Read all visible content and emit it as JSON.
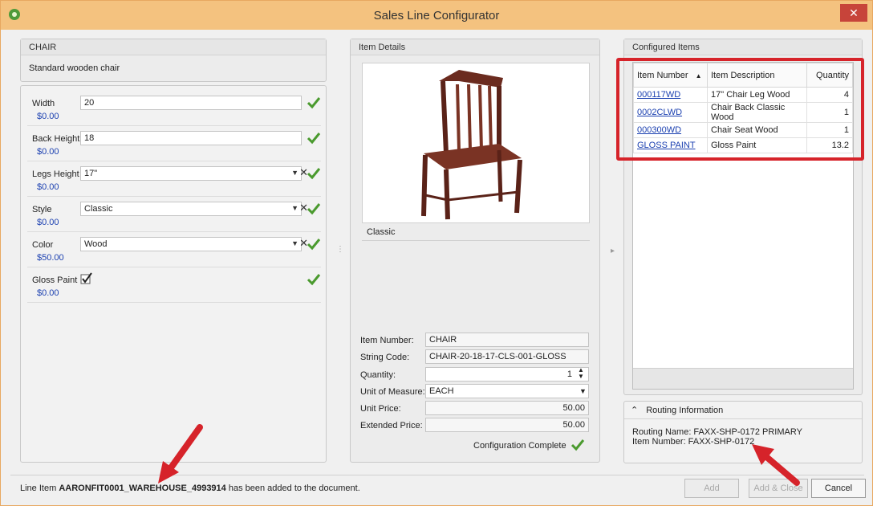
{
  "window": {
    "title": "Sales Line Configurator",
    "close_glyph": "✕"
  },
  "left": {
    "item_code": "CHAIR",
    "item_desc": "Standard wooden chair",
    "fields": [
      {
        "label": "Width",
        "value": "20",
        "price": "$0.00",
        "type": "text"
      },
      {
        "label": "Back Height",
        "value": "18",
        "price": "$0.00",
        "type": "text"
      },
      {
        "label": "Legs Height",
        "value": "17\"",
        "price": "$0.00",
        "type": "select"
      },
      {
        "label": "Style",
        "value": "Classic",
        "price": "$0.00",
        "type": "select"
      },
      {
        "label": "Color",
        "value": "Wood",
        "price": "$50.00",
        "type": "select"
      },
      {
        "label": "Gloss Paint",
        "value": "",
        "price": "$0.00",
        "type": "checkbox"
      }
    ]
  },
  "middle": {
    "header": "Item Details",
    "image_caption": "Classic",
    "labels": {
      "item_number": "Item Number:",
      "string_code": "String Code:",
      "quantity": "Quantity:",
      "uom": "Unit of Measure:",
      "unit_price": "Unit Price:",
      "extended_price": "Extended Price:"
    },
    "values": {
      "item_number": "CHAIR",
      "string_code": "CHAIR-20-18-17-CLS-001-GLOSS",
      "quantity": "1",
      "uom": "EACH",
      "unit_price": "50.00",
      "extended_price": "50.00"
    },
    "config_status": "Configuration Complete"
  },
  "right": {
    "header": "Configured Items",
    "columns": [
      "Item Number",
      "Item Description",
      "Quantity"
    ],
    "rows": [
      [
        "000117WD",
        "17\" Chair Leg Wood",
        "4"
      ],
      [
        "0002CLWD",
        "Chair Back Classic Wood",
        "1"
      ],
      [
        "000300WD",
        "Chair Seat Wood",
        "1"
      ],
      [
        "GLOSS PAINT",
        "Gloss Paint",
        "13.2"
      ]
    ],
    "routing": {
      "header": "Routing Information",
      "line1": "Routing Name: FAXX-SHP-0172 PRIMARY",
      "line2": "Item Number: FAXX-SHP-0172"
    }
  },
  "status": {
    "prefix": "Line Item ",
    "line_item": "AARONFIT0001_WAREHOUSE_4993914",
    "suffix": " has been added to the document."
  },
  "buttons": {
    "add": "Add",
    "add_close": "Add & Close",
    "cancel": "Cancel"
  },
  "colors": {
    "accent": "#f4c27f",
    "link": "#1a3fb0",
    "check": "#4a9a2e",
    "annotation": "#d6232a"
  },
  "icons": [
    "app-icon",
    "close-icon",
    "check-icon",
    "dropdown-icon",
    "clear-icon",
    "checkbox-icon",
    "spin-icon",
    "sort-up-icon",
    "collapse-icon",
    "arrow-annotation"
  ]
}
